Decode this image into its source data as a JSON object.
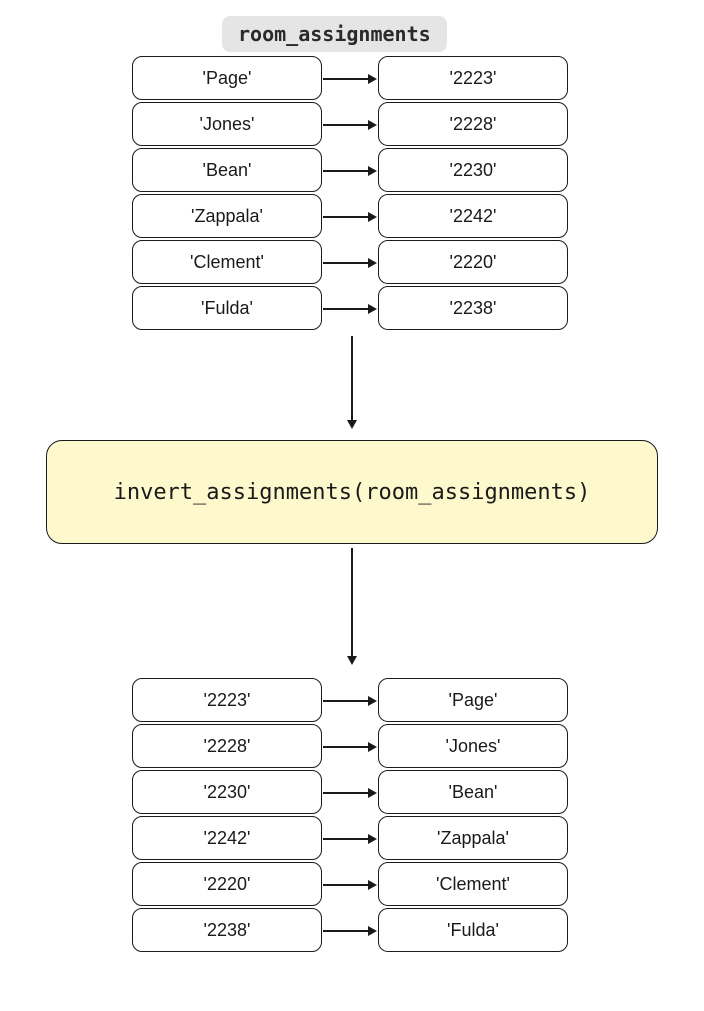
{
  "title_label": "room_assignments",
  "function_call": "invert_assignments(room_assignments)",
  "input_pairs": [
    {
      "key": "'Page'",
      "value": "'2223'"
    },
    {
      "key": "'Jones'",
      "value": "'2228'"
    },
    {
      "key": "'Bean'",
      "value": "'2230'"
    },
    {
      "key": "'Zappala'",
      "value": "'2242'"
    },
    {
      "key": "'Clement'",
      "value": "'2220'"
    },
    {
      "key": "'Fulda'",
      "value": "'2238'"
    }
  ],
  "output_pairs": [
    {
      "key": "'2223'",
      "value": "'Page'"
    },
    {
      "key": "'2228'",
      "value": "'Jones'"
    },
    {
      "key": "'2230'",
      "value": "'Bean'"
    },
    {
      "key": "'2242'",
      "value": "'Zappala'"
    },
    {
      "key": "'2220'",
      "value": "'Clement'"
    },
    {
      "key": "'2238'",
      "value": "'Fulda'"
    }
  ]
}
